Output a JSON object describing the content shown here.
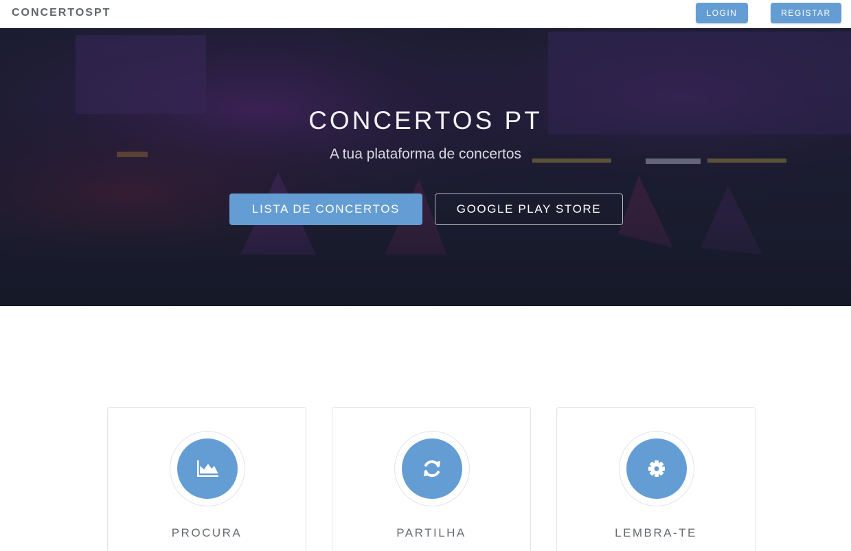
{
  "navbar": {
    "brand": "CONCERTOSPT",
    "login_label": "LOGIN",
    "register_label": "REGISTAR"
  },
  "hero": {
    "title": "CONCERTOS PT",
    "subtitle": "A tua plataforma de concertos",
    "primary_button": "LISTA DE CONCERTOS",
    "secondary_button": "GOOGLE PLAY STORE"
  },
  "features": [
    {
      "label": "PROCURA",
      "icon": "area-chart-icon"
    },
    {
      "label": "PARTILHA",
      "icon": "refresh-icon"
    },
    {
      "label": "LEMBRA-TE",
      "icon": "gear-icon"
    }
  ],
  "colors": {
    "accent": "#649dd3",
    "hero_bg": "#171a2b",
    "brand_text": "#5f646b"
  }
}
